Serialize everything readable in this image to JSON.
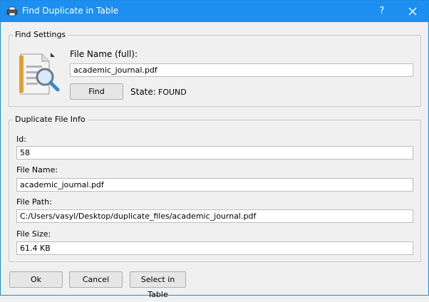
{
  "window": {
    "title": "Find Duplicate in Table",
    "help_label": "?"
  },
  "find_settings": {
    "group_title": "Find Settings",
    "file_name_label": "File Name (full):",
    "file_name_value": "academic_journal.pdf",
    "find_button": "Find",
    "state_label": "State:",
    "state_value": "FOUND"
  },
  "duplicate_info": {
    "group_title": "Duplicate File Info",
    "id_label": "Id:",
    "id_value": "58",
    "file_name_label": "File Name:",
    "file_name_value": "academic_journal.pdf",
    "file_path_label": "File Path:",
    "file_path_value": "C:/Users/vasyl/Desktop/duplicate_files/academic_journal.pdf",
    "file_size_label": "File Size:",
    "file_size_value": "61.4 KB"
  },
  "buttons": {
    "ok": "Ok",
    "cancel": "Cancel",
    "select_in_table": "Select in Table"
  },
  "colors": {
    "titlebar": "#1c8ff0",
    "window_bg": "#f0f0f0"
  },
  "icons": {
    "app": "printer-icon",
    "find": "document-search-icon",
    "close": "close-icon"
  }
}
